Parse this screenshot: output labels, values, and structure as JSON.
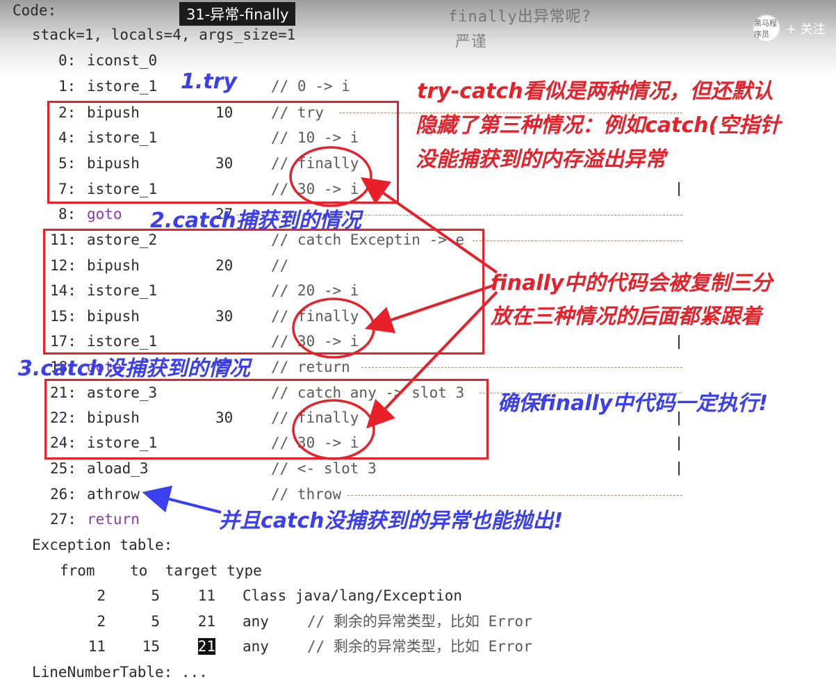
{
  "video": {
    "title": "31-异常-finally",
    "ghost_line1": "finally出异常呢?",
    "ghost_line2": "严谨",
    "follow_label": "+ 关注",
    "avatar_text": "黑马程序员"
  },
  "code": {
    "header": "Code:",
    "stack": "stack=1, locals=4, args_size=1",
    "lines": [
      {
        "off": "0:",
        "op": "iconst_0",
        "arg": "",
        "comment": ""
      },
      {
        "off": "1:",
        "op": "istore_1",
        "arg": "",
        "comment": "// 0 -> i"
      },
      {
        "off": "2:",
        "op": "bipush",
        "arg": "10",
        "comment": "// try"
      },
      {
        "off": "4:",
        "op": "istore_1",
        "arg": "",
        "comment": "// 10 -> i"
      },
      {
        "off": "5:",
        "op": "bipush",
        "arg": "30",
        "comment": "// finally"
      },
      {
        "off": "7:",
        "op": "istore_1",
        "arg": "",
        "comment": "// 30 -> i"
      },
      {
        "off": "8:",
        "op": "goto",
        "arg": "27",
        "comment": ""
      },
      {
        "off": "11:",
        "op": "astore_2",
        "arg": "",
        "comment": "// catch Exceptin -> e"
      },
      {
        "off": "12:",
        "op": "bipush",
        "arg": "20",
        "comment": "//"
      },
      {
        "off": "14:",
        "op": "istore_1",
        "arg": "",
        "comment": "// 20 -> i"
      },
      {
        "off": "15:",
        "op": "bipush",
        "arg": "30",
        "comment": "// finally"
      },
      {
        "off": "17:",
        "op": "istore_1",
        "arg": "",
        "comment": "// 30 -> i"
      },
      {
        "off": "18:",
        "op": "goto",
        "arg": "27",
        "comment": "// return"
      },
      {
        "off": "21:",
        "op": "astore_3",
        "arg": "",
        "comment": "// catch any -> slot 3"
      },
      {
        "off": "22:",
        "op": "bipush",
        "arg": "30",
        "comment": "// finally"
      },
      {
        "off": "24:",
        "op": "istore_1",
        "arg": "",
        "comment": "// 30 -> i"
      },
      {
        "off": "25:",
        "op": "aload_3",
        "arg": "",
        "comment": "// <- slot 3"
      },
      {
        "off": "26:",
        "op": "athrow",
        "arg": "",
        "comment": "// throw"
      },
      {
        "off": "27:",
        "op": "return",
        "arg": "",
        "comment": ""
      }
    ],
    "exception_table_label": "Exception table:",
    "exception_header": "from    to  target type",
    "exception_rows": [
      {
        "from": "2",
        "to": "5",
        "target": "11",
        "type": "Class java/lang/Exception",
        "comment": ""
      },
      {
        "from": "2",
        "to": "5",
        "target": "21",
        "type": "any",
        "comment": "// 剩余的异常类型，比如 Error"
      },
      {
        "from": "11",
        "to": "15",
        "target": "21",
        "type": "any",
        "comment": "// 剩余的异常类型，比如 Error"
      }
    ],
    "line_number_table": "LineNumberTable: ..."
  },
  "annotations": {
    "try_label": "1.try",
    "catch_label": "2.catch捕获到的情况",
    "catch_miss_label": "3.catch没捕获到的情况",
    "note_red_1": "try-catch看似是两种情况，但还默认",
    "note_red_2": "隐藏了第三种情况：例如catch(空指针",
    "note_red_3": "没能捕获到的内存溢出异常",
    "finally_copy_1": "finally中的代码会被复制三分",
    "finally_copy_2": "放在三种情况的后面都紧跟着",
    "ensure": "确保finally中代码一定执行!",
    "throw_note": "并且catch没捕获到的异常也能抛出!"
  },
  "colors": {
    "red": "#e8202a",
    "blue": "#3b3ff0",
    "keyword": "#8b3aa8"
  }
}
